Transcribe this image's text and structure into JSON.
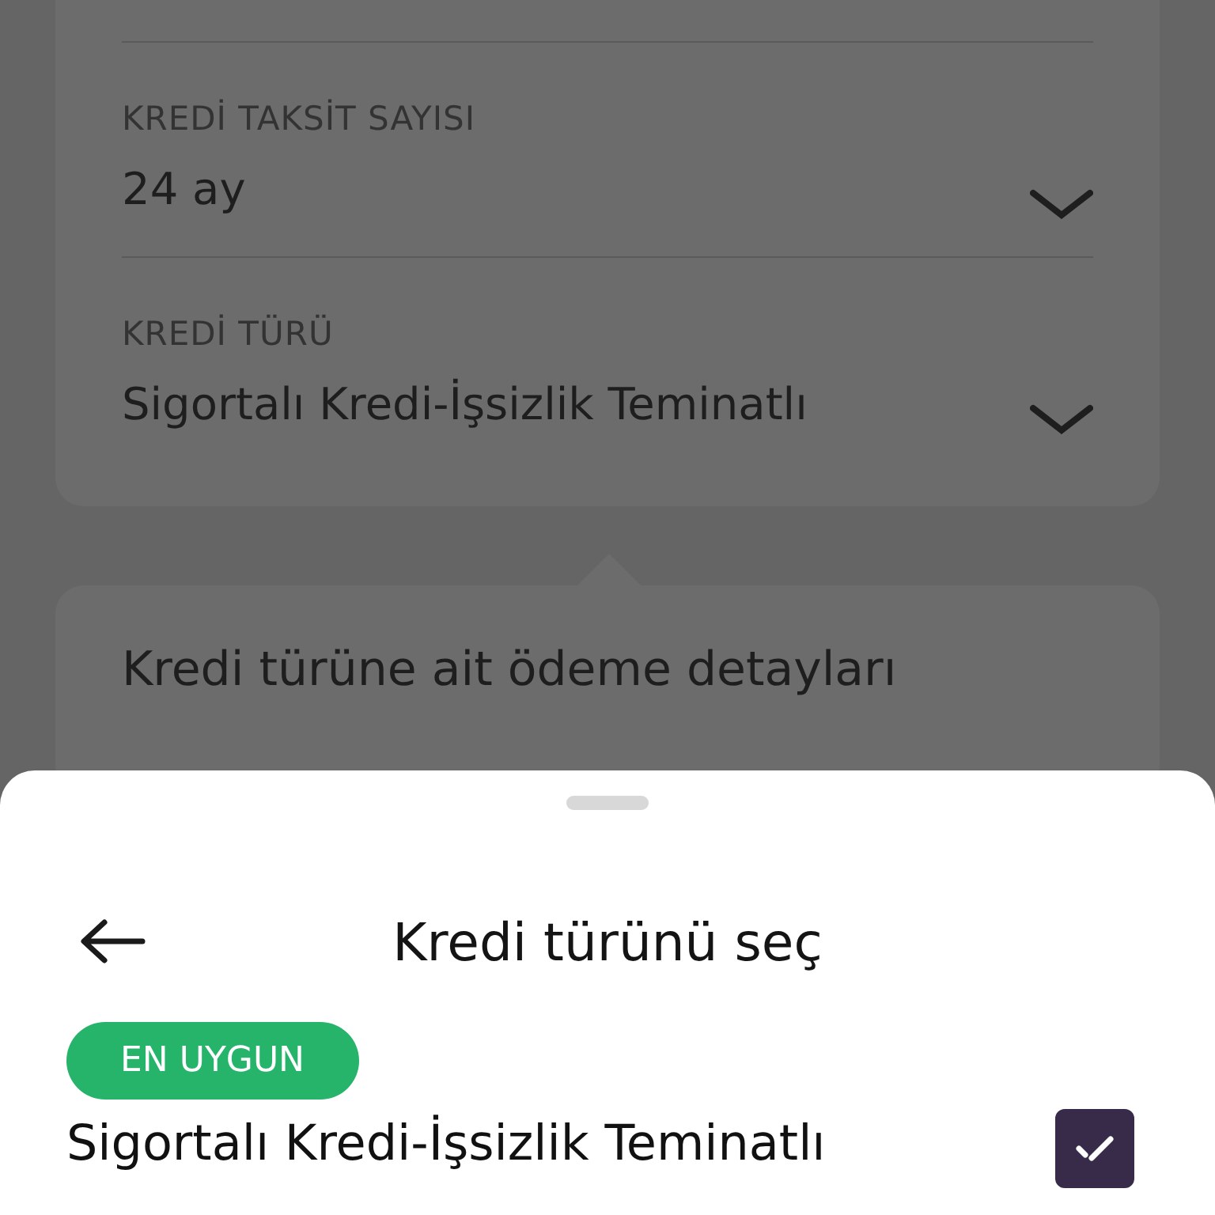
{
  "form": {
    "fields": [
      {
        "label": "KREDİ TAKSİT SAYISI",
        "value": "24 ay"
      },
      {
        "label": "KREDİ TÜRÜ",
        "value": "Sigortalı Kredi-İşsizlik Teminatlı"
      }
    ]
  },
  "details_card": {
    "title": "Kredi türüne ait ödeme detayları"
  },
  "sheet": {
    "title": "Kredi türünü seç",
    "options": [
      {
        "badge": "EN UYGUN",
        "name": "Sigortalı Kredi-İşsizlik Teminatlı",
        "selected": true
      }
    ]
  }
}
